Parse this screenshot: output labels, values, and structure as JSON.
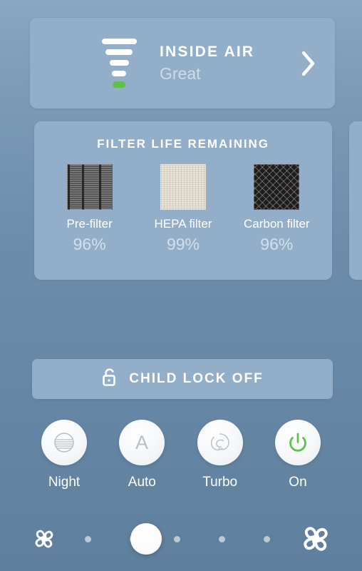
{
  "theme": {
    "background": "#6d8dab",
    "card": "#93aec9",
    "accent_green": "#5cc24a",
    "text_primary": "#ffffff",
    "text_muted": "#d3e0ec"
  },
  "inside_air": {
    "title": "INSIDE AIR",
    "status": "Great",
    "chevron_icon": "chevron-right-icon",
    "indicator_icon": "air-quality-bars-icon",
    "bars": [
      {
        "level": 5,
        "color": "#ffffff"
      },
      {
        "level": 4,
        "color": "#ffffff"
      },
      {
        "level": 3,
        "color": "#ffffff"
      },
      {
        "level": 2,
        "color": "#ffffff"
      },
      {
        "level": 1,
        "color": "#5cc24a"
      }
    ]
  },
  "filter_card": {
    "title": "FILTER LIFE REMAINING",
    "filters": [
      {
        "name": "Pre-filter",
        "value": "96%",
        "icon": "pre-filter-thumbnail"
      },
      {
        "name": "HEPA filter",
        "value": "99%",
        "icon": "hepa-filter-thumbnail"
      },
      {
        "name": "Carbon filter",
        "value": "96%",
        "icon": "carbon-filter-thumbnail"
      }
    ]
  },
  "child_lock": {
    "label": "CHILD LOCK OFF",
    "icon": "unlocked-padlock-icon",
    "state": "off"
  },
  "modes": [
    {
      "label": "Night",
      "icon": "night-mode-icon",
      "active": false
    },
    {
      "label": "Auto",
      "icon": "auto-mode-icon",
      "glyph": "A",
      "active": false
    },
    {
      "label": "Turbo",
      "icon": "turbo-swirl-icon",
      "active": false
    },
    {
      "label": "On",
      "icon": "power-icon",
      "active": true,
      "color": "#5cc24a"
    }
  ],
  "fan_slider": {
    "min_icon": "fan-small-icon",
    "max_icon": "fan-large-icon",
    "steps": 5,
    "value": 2
  }
}
